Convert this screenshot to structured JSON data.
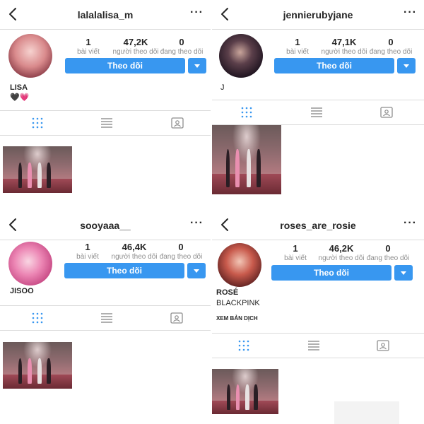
{
  "profiles": [
    {
      "username": "lalalalisa_m",
      "posts": "1",
      "posts_label": "bài viết",
      "followers": "47,2K",
      "followers_label": "người theo dõi",
      "following": "0",
      "following_label": "đang theo dõi",
      "follow_label": "Theo dõi",
      "name": "LISA",
      "bio": "🖤💗"
    },
    {
      "username": "jennierubyjane",
      "posts": "1",
      "posts_label": "bài viết",
      "followers": "47,1K",
      "followers_label": "người theo dõi",
      "following": "0",
      "following_label": "đang theo dõi",
      "follow_label": "Theo dõi",
      "name": "J"
    },
    {
      "username": "sooyaaa__",
      "posts": "1",
      "posts_label": "bài viết",
      "followers": "46,4K",
      "followers_label": "người theo dõi",
      "following": "0",
      "following_label": "đang theo dõi",
      "follow_label": "Theo dõi",
      "name": "JISOO"
    },
    {
      "username": "roses_are_rosie",
      "posts": "1",
      "posts_label": "bài viết",
      "followers": "46,2K",
      "followers_label": "người theo dõi",
      "following": "0",
      "following_label": "đang theo dõi",
      "follow_label": "Theo dõi",
      "name": "ROSÉ",
      "bio": "BLACKPINK",
      "translate_label": "XEM BẢN DỊCH"
    }
  ],
  "icons": {
    "back": "chevron-left-icon",
    "more": "more-horizontal-icon",
    "grid": "grid-icon",
    "list": "list-icon",
    "tagged": "tagged-icon",
    "dropdown": "caret-down-icon"
  },
  "colors": {
    "accent": "#3897f0",
    "text": "#262626",
    "muted": "#8e8e8e",
    "border": "#dbdbdb"
  }
}
